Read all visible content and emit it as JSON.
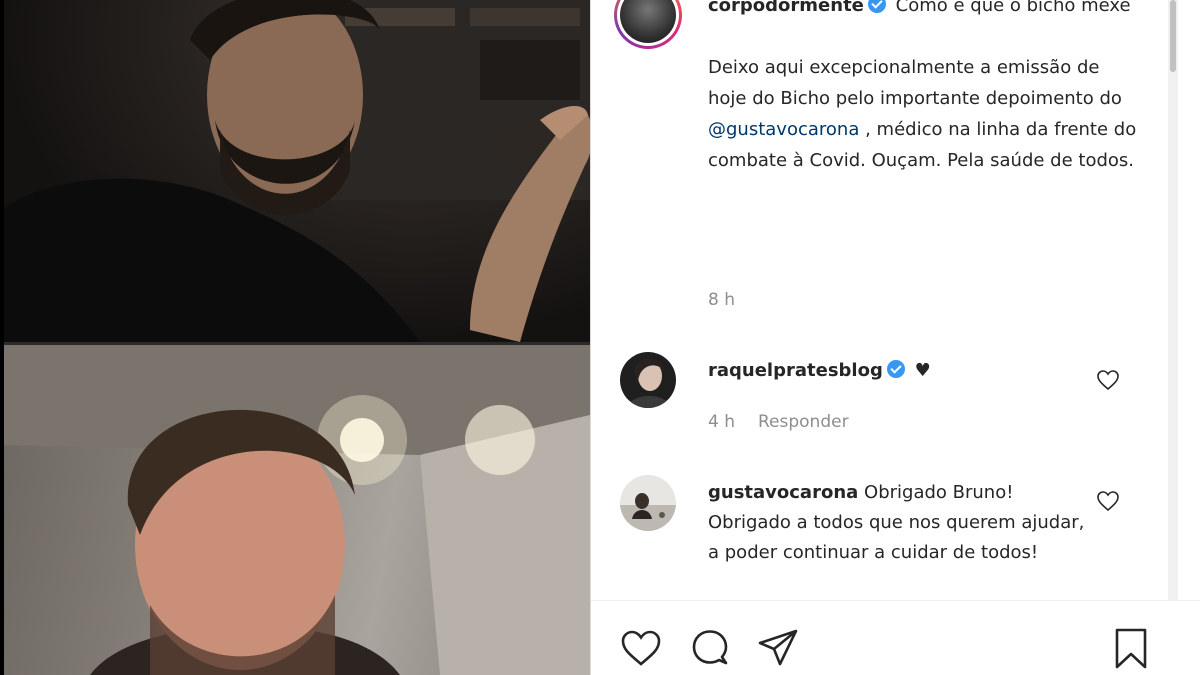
{
  "post": {
    "username": "corpodormente",
    "caption_line1": "Como é que o bicho mexe",
    "caption_p1": "Deixo aqui excepcionalmente a emissão de hoje do Bicho pelo importante depoimento do",
    "mention": "@gustavocarona",
    "caption_p2": ", médico na linha da frente do combate à Covid. Ouçam. Pela saúde de todos.",
    "time": "8 h"
  },
  "comments": [
    {
      "username": "raquelprates​blog",
      "verified": true,
      "text": "♥",
      "time": "4 h",
      "reply_label": "Responder"
    },
    {
      "username": "gustavocarona",
      "verified": false,
      "text": "Obrigado Bruno! Obrigado a todos que nos querem ajudar, a poder continuar a cuidar de todos!"
    }
  ],
  "icons": {
    "like": "heart-icon",
    "comment": "comment-icon",
    "share": "share-icon",
    "save": "bookmark-icon"
  },
  "colors": {
    "verified": "#3897f0",
    "mention": "#00376b",
    "muted": "#8e8e8e"
  }
}
